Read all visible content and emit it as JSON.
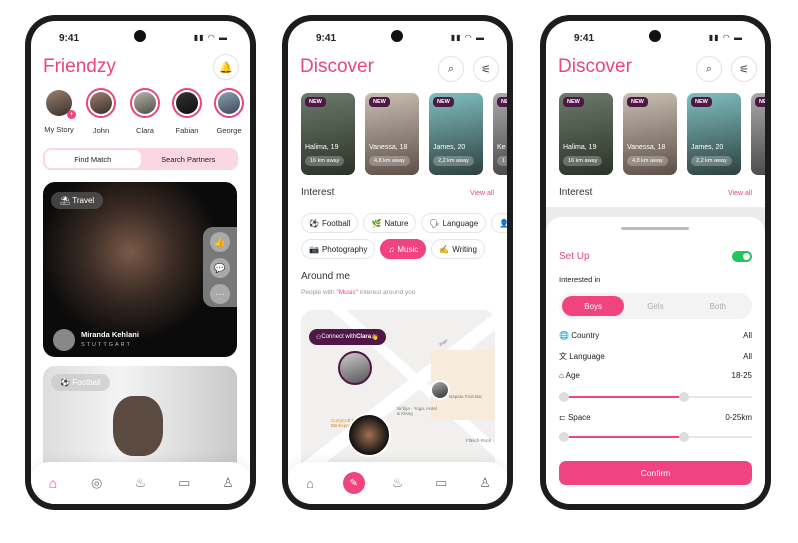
{
  "status": {
    "time": "9:41",
    "icons": "signal-wifi-battery"
  },
  "home": {
    "title": "Friendzy",
    "bell_icon": "bell-icon",
    "stories": [
      {
        "name": "My Story"
      },
      {
        "name": "John"
      },
      {
        "name": "Clara"
      },
      {
        "name": "Fabian"
      },
      {
        "name": "George"
      }
    ],
    "tabs": [
      "Find Match",
      "Search Partners"
    ],
    "card": {
      "tag": "Travel",
      "name": "Miranda Kehlani",
      "location": "STUTTGART",
      "actions": [
        "like-icon",
        "comment-icon",
        "more-icon"
      ]
    },
    "card2": {
      "tag": "Football"
    }
  },
  "discover": {
    "title": "Discover",
    "profiles": [
      {
        "badge": "NEW",
        "name": "Halima, 19",
        "distance": "16 km away"
      },
      {
        "badge": "NEW",
        "name": "Vanessa, 18",
        "distance": "4,8 km away"
      },
      {
        "badge": "NEW",
        "name": "James, 20",
        "distance": "2,2 km away"
      },
      {
        "badge": "NEW",
        "name": "Ke",
        "distance": "1"
      }
    ],
    "interest_label": "Interest",
    "view_all": "View all",
    "interests": [
      {
        "icon": "⚽",
        "label": "Football"
      },
      {
        "icon": "🌿",
        "label": "Nature"
      },
      {
        "icon": "🗣",
        "label": "Language"
      },
      {
        "icon": "📷",
        "label": "Photography"
      },
      {
        "icon": "♫",
        "label": "Music",
        "selected": true
      },
      {
        "icon": "✍",
        "label": "Writing"
      }
    ],
    "around_title": "Around me",
    "around_sub_pre": "People with ",
    "around_sub_hl": "\"Music\"",
    "around_sub_post": " interest around you",
    "connect_pre": "Connect with ",
    "connect_name": "Clara",
    "connect_emoji": "👋",
    "map_labels": [
      "Nirbija - Yoga, Hotel & Klang",
      "Temporarily closed",
      "Napata Fruit Bar",
      "CurryCult Treff BB-Express",
      "Fläsch-Rock",
      "Plan"
    ]
  },
  "setup": {
    "title": "Set Up",
    "toggle_on": true,
    "interested_label": "Interested in",
    "options": [
      "Boys",
      "Girls",
      "Both"
    ],
    "selected": "Boys",
    "rows": [
      {
        "icon": "globe-icon",
        "label": "Country",
        "value": "All"
      },
      {
        "icon": "translate-icon",
        "label": "Language",
        "value": "All"
      },
      {
        "icon": "cake-icon",
        "label": "Age",
        "value": "18-25"
      },
      {
        "icon": "signpost-icon",
        "label": "Space",
        "value": "0-25km"
      }
    ],
    "age_slider": 0.65,
    "space_slider": 0.65,
    "confirm": "Confirm"
  },
  "nav": [
    "home",
    "explore",
    "flame",
    "chat",
    "profile"
  ],
  "colors": {
    "accent": "#f0437f",
    "badge": "#4e1746",
    "toggle": "#22c55e"
  }
}
